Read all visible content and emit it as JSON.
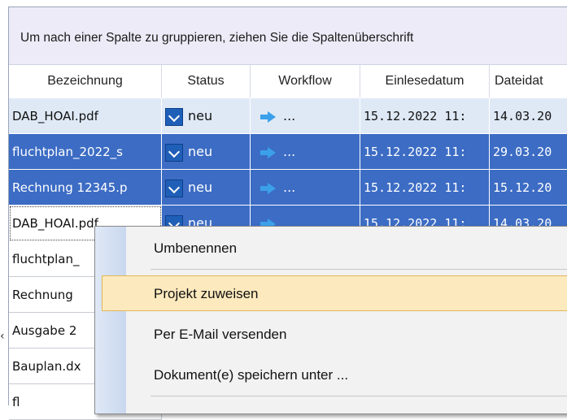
{
  "group_panel": {
    "hint": "Um nach einer Spalte zu gruppieren, ziehen Sie die Spaltenüberschrift"
  },
  "columns": [
    "Bezeichnung",
    "Status",
    "Workflow",
    "Einlesedatum",
    "Dateidat"
  ],
  "rows": [
    {
      "name": "DAB_HOAI.pdf",
      "status": "neu",
      "workflow": "...",
      "einlese": "15.12.2022 11:",
      "datei": "14.03.20",
      "state": "light"
    },
    {
      "name": "fluchtplan_2022_s",
      "status": "neu",
      "workflow": "...",
      "einlese": "15.12.2022 11:",
      "datei": "29.03.20",
      "state": "selected"
    },
    {
      "name": "Rechnung 12345.p",
      "status": "neu",
      "workflow": "...",
      "einlese": "15.12.2022 11:",
      "datei": "15.12.20",
      "state": "selected"
    },
    {
      "name": "DAB_HOAI.pdf",
      "status": "neu",
      "workflow": "",
      "einlese": "15.12.2022 11:",
      "datei": "14.03.20",
      "state": "selected"
    },
    {
      "name": "fluchtplan_",
      "state": "plain"
    },
    {
      "name": "Rechnung",
      "state": "plain"
    },
    {
      "name": "Ausgabe 2",
      "state": "plain"
    },
    {
      "name": "Bauplan.dx",
      "state": "plain"
    },
    {
      "name": "fl",
      "state": "plain"
    }
  ],
  "context_menu": {
    "items": [
      "Umbenennen",
      "Projekt zuweisen",
      "Per E-Mail versenden",
      "Dokument(e) speichern unter ..."
    ],
    "highlighted": "Projekt zuweisen"
  },
  "colors": {
    "selected_row": "#3c6cc4",
    "light_row": "#dfe9f6",
    "menu_highlight": "#fce9bd"
  },
  "icons": {
    "status": "inbox-download-icon",
    "workflow": "arrow-right-icon"
  }
}
